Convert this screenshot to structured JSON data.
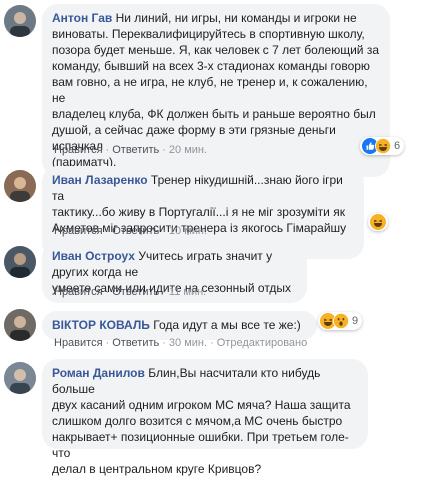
{
  "comments": [
    {
      "author": "Антон Гав",
      "lines": [
        "Ни линий, ни игры, ни команды и игроки не",
        "виноваты. Переквалифицируйтесь в спортивную школу,",
        "позора будет меньше. Я, как человек с 7 лет болеющий за",
        "команду, бывший на всех 3-х стадионах команды говорю",
        "вам говно, а не игра, не клуб, не тренер и, к сожалению, не",
        "владелец клуба, ФК должен быть и раньше вероятно был",
        "душой, а сейчас даже форму в эти грязные деньги испачкал",
        "(париматч)."
      ],
      "like": "Нравится",
      "reply": "Ответить",
      "time": "20 мин.",
      "reaction_count": "6",
      "reaction_icons": [
        "like-icon",
        "haha-icon"
      ],
      "avatar_color": "#6d7a86"
    },
    {
      "author": "Иван Лазаренко",
      "lines": [
        "Тренер нікудишній...знаю його ігри та",
        "тактику...бо живу в Португалії...і я не міг зрозуміти як",
        "Ахметов міг запросити тренера із якогось Гімарайшу ..."
      ],
      "like": "Нравится",
      "reply": "Ответить",
      "time": "10 мин.",
      "reaction_icons": [
        "haha-icon"
      ],
      "avatar_color": "#8a6a55"
    },
    {
      "author": "Иван Остроух",
      "lines": [
        "Учитесь играть значит у других когда не",
        "умеете сами или идите на сезонный отдых"
      ],
      "like": "Нравится",
      "reply": "Ответить",
      "time": "11 мин.",
      "avatar_color": "#4a5866"
    },
    {
      "author": "ВІКТОР КОВАЛЬ",
      "lines": [
        "Года идут а мы все те же:)"
      ],
      "like": "Нравится",
      "reply": "Ответить",
      "time": "30 мин.",
      "edited": "Отредактировано",
      "reaction_count": "9",
      "reaction_icons": [
        "haha-icon",
        "wow-icon"
      ],
      "avatar_color": "#6f6a63"
    },
    {
      "author": "Роман Данилов",
      "lines": [
        "Блин,Вы насчитали кто нибудь больше",
        "двух касаний одним игроком МС мяча? Наша защита",
        "слишком долго возится с мячом,а МС очень быстро",
        "накрывает+ позиционные ошибки. При третьем голе- что",
        "делал в центральном круге Кривцов?"
      ],
      "avatar_color": "#7b8794"
    }
  ],
  "colors": {
    "author": "#385898",
    "bubble": "#f2f3f5",
    "meta": "#90949c",
    "like_blue": "#1877f2",
    "emoji_yellow": "#f7b125"
  }
}
